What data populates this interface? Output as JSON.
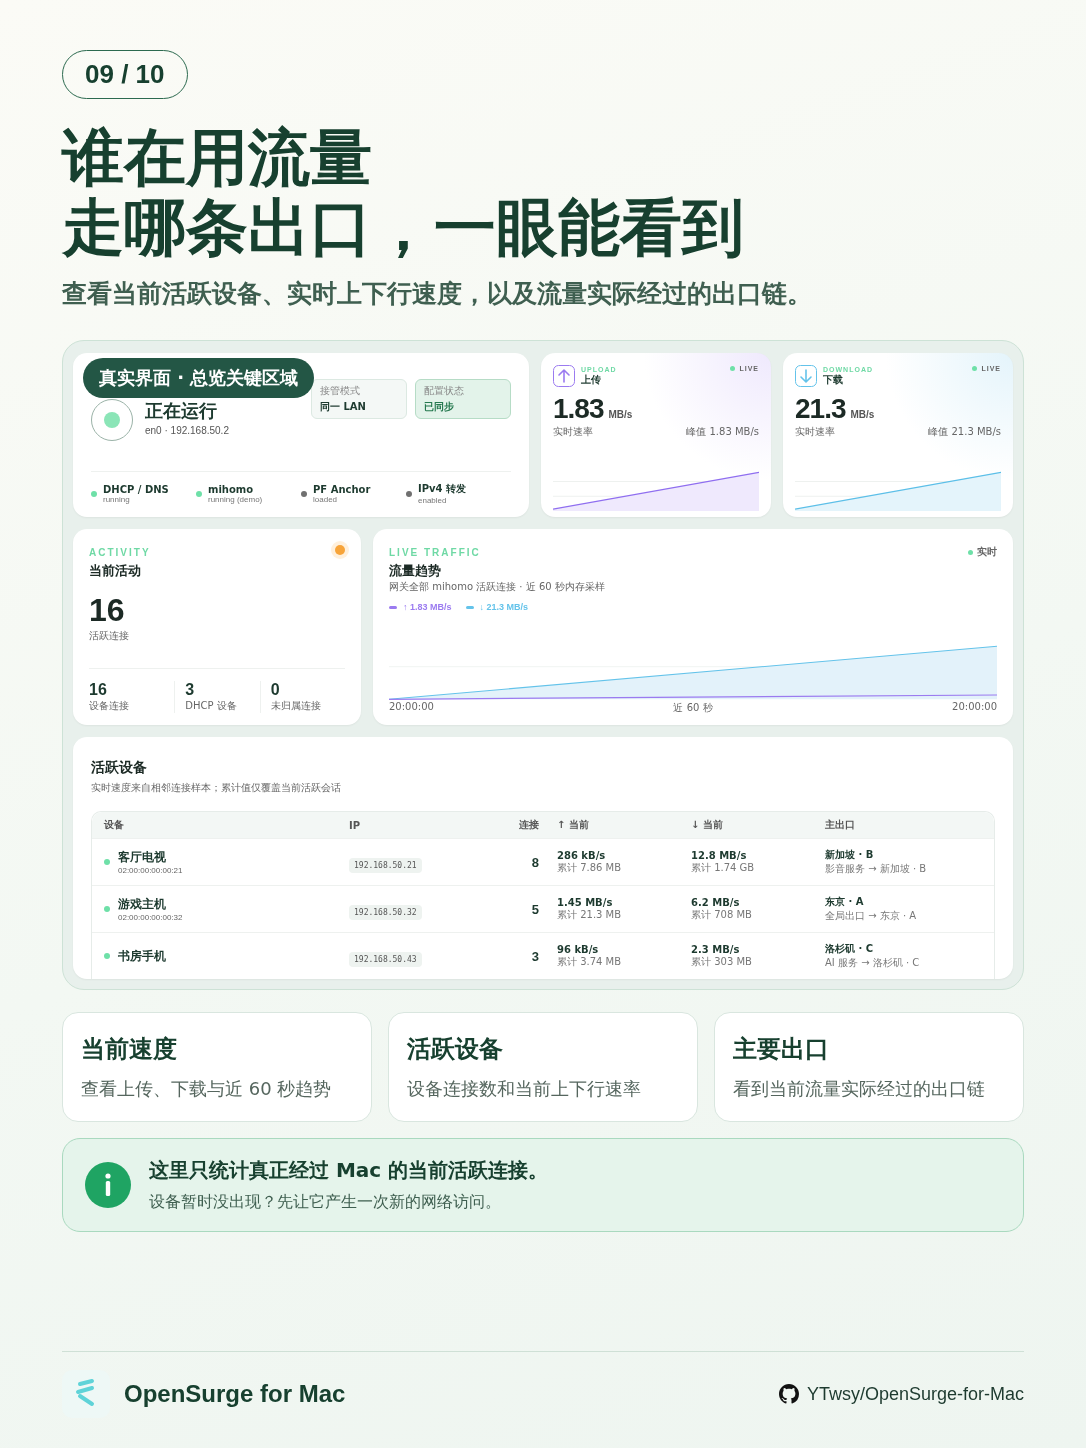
{
  "page_counter": "09 / 10",
  "headline": [
    "谁在用流量",
    "走哪条出口，一眼能看到"
  ],
  "subtitle": "查看当前活跃设备、实时上下行速度，以及流量实际经过的出口链。",
  "badge": "真实界面 · 总览关键区域",
  "overview": {
    "title": "正在运行",
    "address": "en0 · 192.168.50.2",
    "fields": [
      {
        "label": "接管模式",
        "value": "同一 LAN",
        "highlighted": false
      },
      {
        "label": "配置状态",
        "value": "已同步",
        "highlighted": true
      }
    ],
    "services": [
      {
        "name": "DHCP / DNS",
        "status": "running",
        "color": "#6ee0a8"
      },
      {
        "name": "mihomo",
        "status": "running (demo)",
        "color": "#6ee0a8"
      },
      {
        "name": "PF Anchor",
        "status": "loaded",
        "color": "#707070"
      },
      {
        "name": "IPv4 转发",
        "status": "enabled",
        "color": "#707070"
      }
    ]
  },
  "meters": [
    {
      "kind": "upload",
      "eyebrow": "UPLOAD",
      "title": "上传",
      "live": "LIVE",
      "value": "1.83",
      "unit": "MB/s",
      "caption": "实时速率",
      "peak": "峰值 1.83 MB/s"
    },
    {
      "kind": "download",
      "eyebrow": "DOWNLOAD",
      "title": "下载",
      "live": "LIVE",
      "value": "21.3",
      "unit": "MB/s",
      "caption": "实时速率",
      "peak": "峰值 21.3 MB/s"
    }
  ],
  "activity": {
    "eyebrow": "ACTIVITY",
    "title": "当前活动",
    "value": "16",
    "caption": "活跃连接",
    "stats": [
      {
        "value": "16",
        "label": "设备连接"
      },
      {
        "value": "3",
        "label": "DHCP 设备"
      },
      {
        "value": "0",
        "label": "未归属连接"
      }
    ]
  },
  "traffic": {
    "eyebrow": "LIVE TRAFFIC",
    "title": "流量趋势",
    "live": "实时",
    "description": "网关全部 mihomo 活跃连接 · 近 60 秒内存采样",
    "legend": [
      {
        "label": "↑ 1.83 MB/s",
        "color": "#9b7bf0"
      },
      {
        "label": "↓ 21.3 MB/s",
        "color": "#64c3ea"
      }
    ],
    "x_labels": [
      "20:00:00",
      "近 60 秒",
      "20:00:00"
    ]
  },
  "devices": {
    "title": "活跃设备",
    "description": "实时速度来自相邻连接样本；累计值仅覆盖当前活跃会话",
    "columns": [
      "设备",
      "IP",
      "连接",
      "↑ 当前",
      "↓ 当前",
      "主出口"
    ],
    "rows": [
      {
        "name": "客厅电视",
        "mac": "02:00:00:00:00:21",
        "ip": "192.168.50.21",
        "connections": "8",
        "up": "286 kB/s",
        "up_total": "累计 7.86 MB",
        "down": "12.8 MB/s",
        "down_total": "累计 1.74 GB",
        "exit": "新加坡 · B",
        "route": "影音服务 → 新加坡 · B",
        "color": "#6ee0a8"
      },
      {
        "name": "游戏主机",
        "mac": "02:00:00:00:00:32",
        "ip": "192.168.50.32",
        "connections": "5",
        "up": "1.45 MB/s",
        "up_total": "累计 21.3 MB",
        "down": "6.2 MB/s",
        "down_total": "累计 708 MB",
        "exit": "东京 · A",
        "route": "全局出口 → 东京 · A",
        "color": "#6ee0a8"
      },
      {
        "name": "书房手机",
        "ip": "192.168.50.43",
        "connections": "3",
        "up": "96 kB/s",
        "up_total": "累计 3.74 MB",
        "down": "2.3 MB/s",
        "down_total": "累计 303 MB",
        "exit": "洛杉矶 · C",
        "route": "AI 服务 → 洛杉矶 · C",
        "color": "#6ee0a8"
      }
    ]
  },
  "features": [
    {
      "title": "当前速度",
      "description": "查看上传、下载与近 60 秒趋势"
    },
    {
      "title": "活跃设备",
      "description": "设备连接数和当前上下行速率"
    },
    {
      "title": "主要出口",
      "description": "看到当前流量实际经过的出口链"
    }
  ],
  "notice": {
    "title": "这里只统计真正经过 Mac 的当前活跃连接。",
    "body": "设备暂时没出现？先让它产生一次新的网络访问。"
  },
  "footer": {
    "brand": "OpenSurge for Mac",
    "repo": "YTwsy/OpenSurge-for-Mac"
  }
}
